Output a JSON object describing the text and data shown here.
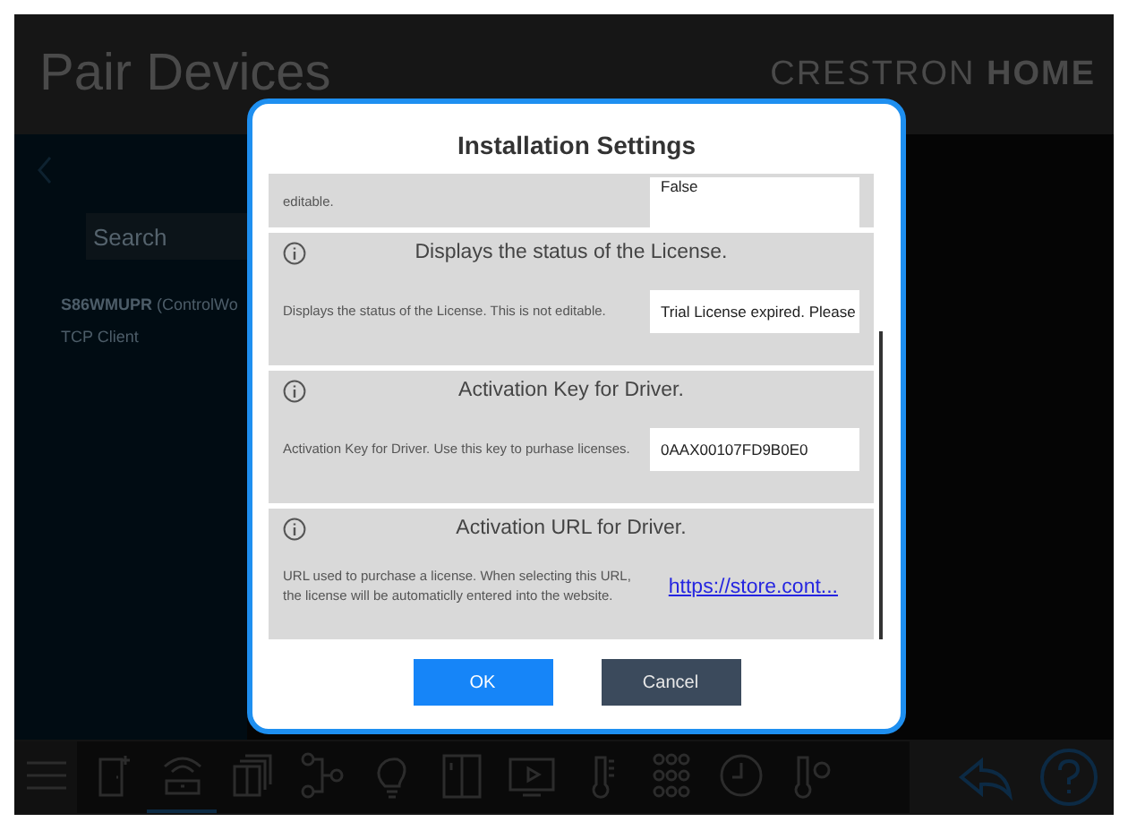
{
  "background": {
    "title": "Pair Devices",
    "brand": {
      "light": "CRESTRON",
      "bold": "HOME"
    },
    "search": {
      "placeholder": "Search"
    },
    "devices": [
      {
        "name": "S86WMUPR",
        "type": "(ControlWo",
        "connection": "TCP Client"
      }
    ],
    "toolbar": [
      {
        "kind": "menu",
        "selected": false
      },
      {
        "kind": "door",
        "selected": false
      },
      {
        "kind": "router",
        "selected": true
      },
      {
        "kind": "panels",
        "selected": false
      },
      {
        "kind": "nodes",
        "selected": false
      },
      {
        "kind": "bulb",
        "selected": false
      },
      {
        "kind": "shade",
        "selected": false
      },
      {
        "kind": "tv",
        "selected": false
      },
      {
        "kind": "thermometer",
        "selected": false
      },
      {
        "kind": "keypad",
        "selected": false
      },
      {
        "kind": "clock",
        "selected": false
      },
      {
        "kind": "thermostat",
        "selected": false
      }
    ],
    "actions": [
      {
        "kind": "back"
      },
      {
        "kind": "help"
      }
    ]
  },
  "dialog": {
    "title": "Installation Settings",
    "settings": [
      {
        "kind": "field",
        "description": "editable.",
        "value": "False"
      },
      {
        "kind": "field",
        "header": "Displays the status of the License.",
        "description": "Displays the status of the License. This is not editable.",
        "value": "Trial License expired. Please"
      },
      {
        "kind": "field",
        "header": "Activation Key for Driver.",
        "description": "Activation Key for Driver. Use this key to purhase licenses.",
        "value": "0AAX00107FD9B0E0"
      },
      {
        "kind": "link",
        "header": "Activation URL for Driver.",
        "description": "URL used to purchase a license. When selecting this URL, the license will be automaticlly entered into the website.",
        "value": "https://store.cont..."
      }
    ],
    "buttons": [
      {
        "kind": "primary",
        "label": "OK"
      },
      {
        "kind": "secondary",
        "label": "Cancel"
      }
    ]
  }
}
